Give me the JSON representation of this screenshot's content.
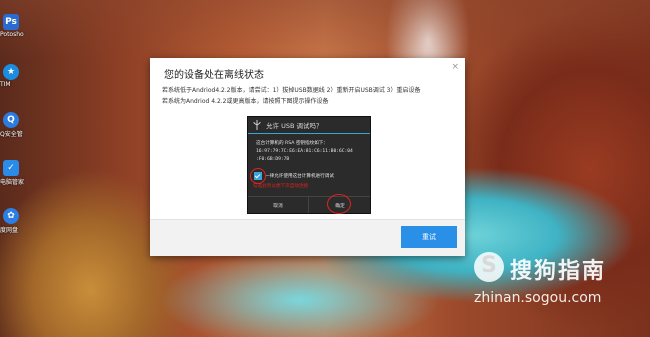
{
  "desktop": {
    "icons": [
      {
        "label": "Potosho",
        "glyph": "Ps",
        "color": "#2a6bd0"
      },
      {
        "label": "TIM",
        "glyph": "★",
        "color": "#1b8de0"
      },
      {
        "label": "Q安全管",
        "glyph": "Q",
        "color": "#2b7be0"
      },
      {
        "label": "电脑管家",
        "glyph": "✓",
        "color": "#2a8be8"
      },
      {
        "label": "度网盘",
        "glyph": "✿",
        "color": "#2c7de4"
      }
    ]
  },
  "dialog": {
    "title": "您的设备处在离线状态",
    "close_glyph": "×",
    "line1": "若系统低于Andriod4.2.2版本，请尝试：1）拔掉USB数据线 2）重新开启USB调试 3）重启设备",
    "line2": "若系统为Andriod 4.2.2或更高版本，请按照下图提示操作设备",
    "retry_label": "重试"
  },
  "usb_prompt": {
    "title": "允许 USB 调试吗？",
    "fingerprint_intro": "这台计算机的 RSA 密钥指纹如下：",
    "fingerprint_line1": "16:97:79:7C:E6:EA:81:C6:11:B0:6C:04",
    "fingerprint_line2": ":F0:6B:D9:7B",
    "always_allow": "一律允许使用这台计算机进行调试",
    "hint": "勾选此项以便下次自动连接",
    "cancel_label": "取消",
    "ok_label": "确定",
    "accent": "#3ba3d6",
    "annotation_color": "#e0241d"
  },
  "watermark": {
    "logo_glyph": "S",
    "name": "搜狗指南",
    "url": "zhinan.sogou.com"
  }
}
